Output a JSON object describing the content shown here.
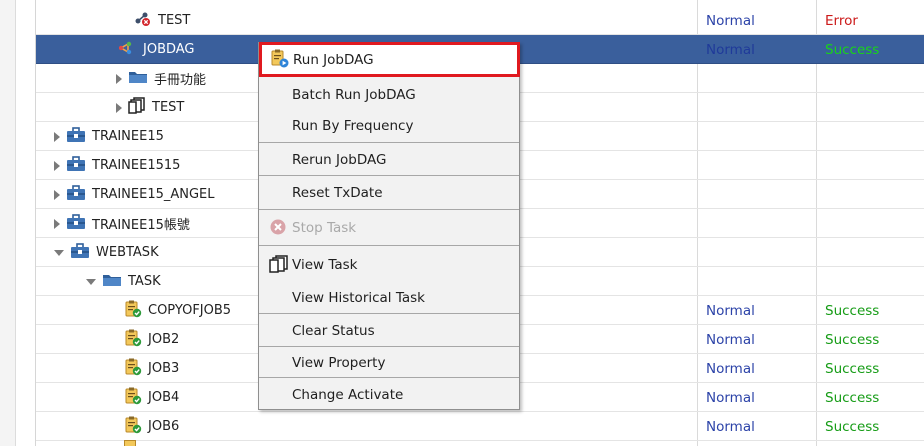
{
  "tree": {
    "rows": [
      {
        "label": "TEST",
        "icon": "job-error-icon",
        "status": "Normal",
        "result": "Error",
        "result_type": "error"
      },
      {
        "label": "JOBDAG",
        "icon": "jobdag-icon",
        "status": "Normal",
        "result": "Success",
        "result_type": "success"
      },
      {
        "label": "手冊功能",
        "icon": "folder-icon",
        "status": "",
        "result": ""
      },
      {
        "label": "TEST",
        "icon": "task-icon",
        "status": "",
        "result": ""
      },
      {
        "label": "TRAINEE15",
        "icon": "briefcase-icon",
        "status": "",
        "result": ""
      },
      {
        "label": "TRAINEE1515",
        "icon": "briefcase-icon",
        "status": "",
        "result": ""
      },
      {
        "label": "TRAINEE15_ANGEL",
        "icon": "briefcase-icon",
        "status": "",
        "result": ""
      },
      {
        "label": "TRAINEE15帳號",
        "icon": "briefcase-icon",
        "status": "",
        "result": ""
      },
      {
        "label": "WEBTASK",
        "icon": "briefcase-icon",
        "status": "",
        "result": ""
      },
      {
        "label": "TASK",
        "icon": "folder-icon",
        "status": "",
        "result": ""
      },
      {
        "label": "COPYOFJOB5",
        "icon": "job-success-icon",
        "status": "Normal",
        "result": "Success",
        "result_type": "success"
      },
      {
        "label": "JOB2",
        "icon": "job-success-icon",
        "status": "Normal",
        "result": "Success",
        "result_type": "success"
      },
      {
        "label": "JOB3",
        "icon": "job-success-icon",
        "status": "Normal",
        "result": "Success",
        "result_type": "success"
      },
      {
        "label": "JOB4",
        "icon": "job-success-icon",
        "status": "Normal",
        "result": "Success",
        "result_type": "success"
      },
      {
        "label": "JOB6",
        "icon": "job-success-icon",
        "status": "Normal",
        "result": "Success",
        "result_type": "success"
      }
    ]
  },
  "context_menu": {
    "items": [
      {
        "label": "Run JobDAG",
        "icon": "run-jobdag-icon"
      },
      {
        "label": "Batch Run JobDAG"
      },
      {
        "label": "Run By Frequency"
      },
      {
        "label": "Rerun JobDAG"
      },
      {
        "label": "Reset TxDate"
      },
      {
        "label": "Stop Task",
        "icon": "stop-icon",
        "disabled": true
      },
      {
        "label": "View Task",
        "icon": "view-task-icon"
      },
      {
        "label": "View Historical Task"
      },
      {
        "label": "Clear Status"
      },
      {
        "label": "View Property"
      },
      {
        "label": "Change Activate"
      }
    ]
  },
  "colors": {
    "selected_row": "#3a5f9c",
    "status_normal": "#2c43a8",
    "result_success": "#169c16",
    "result_error": "#cc1a1a",
    "highlight_border": "#e0191f"
  }
}
